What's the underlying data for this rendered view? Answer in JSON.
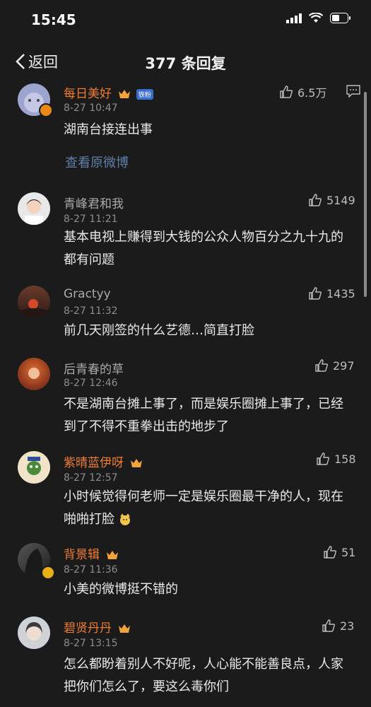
{
  "status": {
    "time": "15:45"
  },
  "header": {
    "back_label": "返回",
    "title": "377 条回复"
  },
  "top_comment": {
    "name": "每日美好",
    "tag": "铁粉",
    "time": "8-27 10:47",
    "text": "湖南台接连出事",
    "likes": "6.5万",
    "link": "查看原微博"
  },
  "comments": [
    {
      "name": "青峰君和我",
      "time": "8-27 11:21",
      "text": "基本电视上赚得到大钱的公众人物百分之九十九的都有问题",
      "likes": "5149"
    },
    {
      "name": "Gractyy",
      "time": "8-27 11:32",
      "text": "前几天刚签的什么艺德…简直打脸",
      "likes": "1435"
    },
    {
      "name": "后青春的草",
      "time": "8-27 12:46",
      "text": "不是湖南台摊上事了，而是娱乐圈摊上事了，已经到了不得不重拳出击的地步了",
      "likes": "297"
    },
    {
      "name": "紫晴蓝伊呀",
      "time": "8-27 12:57",
      "text": "小时候觉得何老师一定是娱乐圈最干净的人，现在啪啪打脸",
      "likes": "158"
    },
    {
      "name": "背景辑",
      "time": "8-27 11:36",
      "text": "小美的微博挺不错的",
      "likes": "51"
    },
    {
      "name": "碧贤丹丹",
      "time": "8-27 13:15",
      "text": "怎么都盼着别人不好呢，人心能不能善良点，人家把你们怎么了，要这么毒你们",
      "likes": "23"
    }
  ],
  "colors": {
    "background": "#1b1b1b",
    "vip_name": "#f07c2d",
    "link": "#5f7ea9"
  }
}
